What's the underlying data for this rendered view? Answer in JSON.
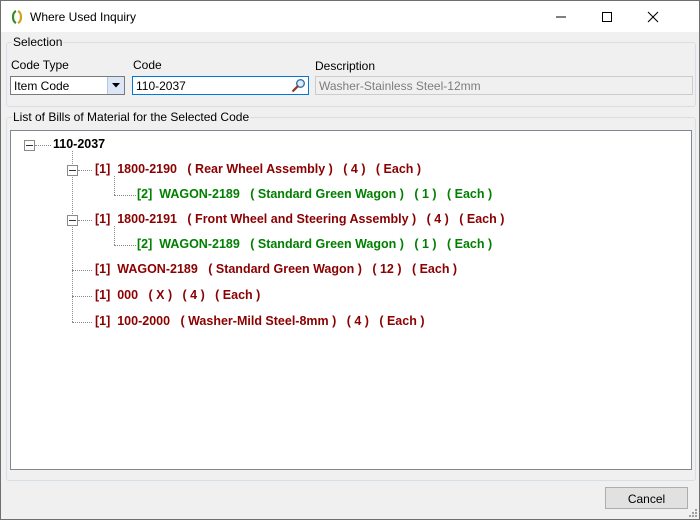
{
  "window": {
    "title": "Where Used Inquiry"
  },
  "selection": {
    "group_label": "Selection",
    "code_type_label": "Code Type",
    "code_type_value": "Item Code",
    "code_label": "Code",
    "code_value": "110-2037",
    "description_label": "Description",
    "description_value": "Washer-Stainless Steel-12mm"
  },
  "list": {
    "group_label": "List of Bills of Material for the Selected Code",
    "root": "110-2037",
    "nodes": [
      {
        "text": "[1]  1800-2190   ( Rear Wheel Assembly )   ( 4 )   ( Each )",
        "color": "#8b0000"
      },
      {
        "text": "[2]  WAGON-2189   ( Standard Green Wagon )   ( 1 )   ( Each )",
        "color": "#008000"
      },
      {
        "text": "[1]  1800-2191   ( Front Wheel and Steering Assembly )   ( 4 )   ( Each )",
        "color": "#8b0000"
      },
      {
        "text": "[2]  WAGON-2189   ( Standard Green Wagon )   ( 1 )   ( Each )",
        "color": "#008000"
      },
      {
        "text": "[1]  WAGON-2189   ( Standard Green Wagon )   ( 12 )   ( Each )",
        "color": "#8b0000"
      },
      {
        "text": "[1]  000   ( X )   ( 4 )   ( Each )",
        "color": "#8b0000"
      },
      {
        "text": "[1]  100-2000   ( Washer-Mild Steel-8mm )   ( 4 )   ( Each )",
        "color": "#8b0000"
      }
    ]
  },
  "buttons": {
    "cancel": "Cancel"
  },
  "icons": {
    "app": "app-icon",
    "minimize": "minimize-icon",
    "maximize": "maximize-icon",
    "close": "close-icon",
    "dropdown": "chevron-down-icon",
    "search": "search-icon"
  },
  "colors": {
    "level1": "#8b0000",
    "level2": "#008000",
    "focus_border": "#0078d7"
  }
}
